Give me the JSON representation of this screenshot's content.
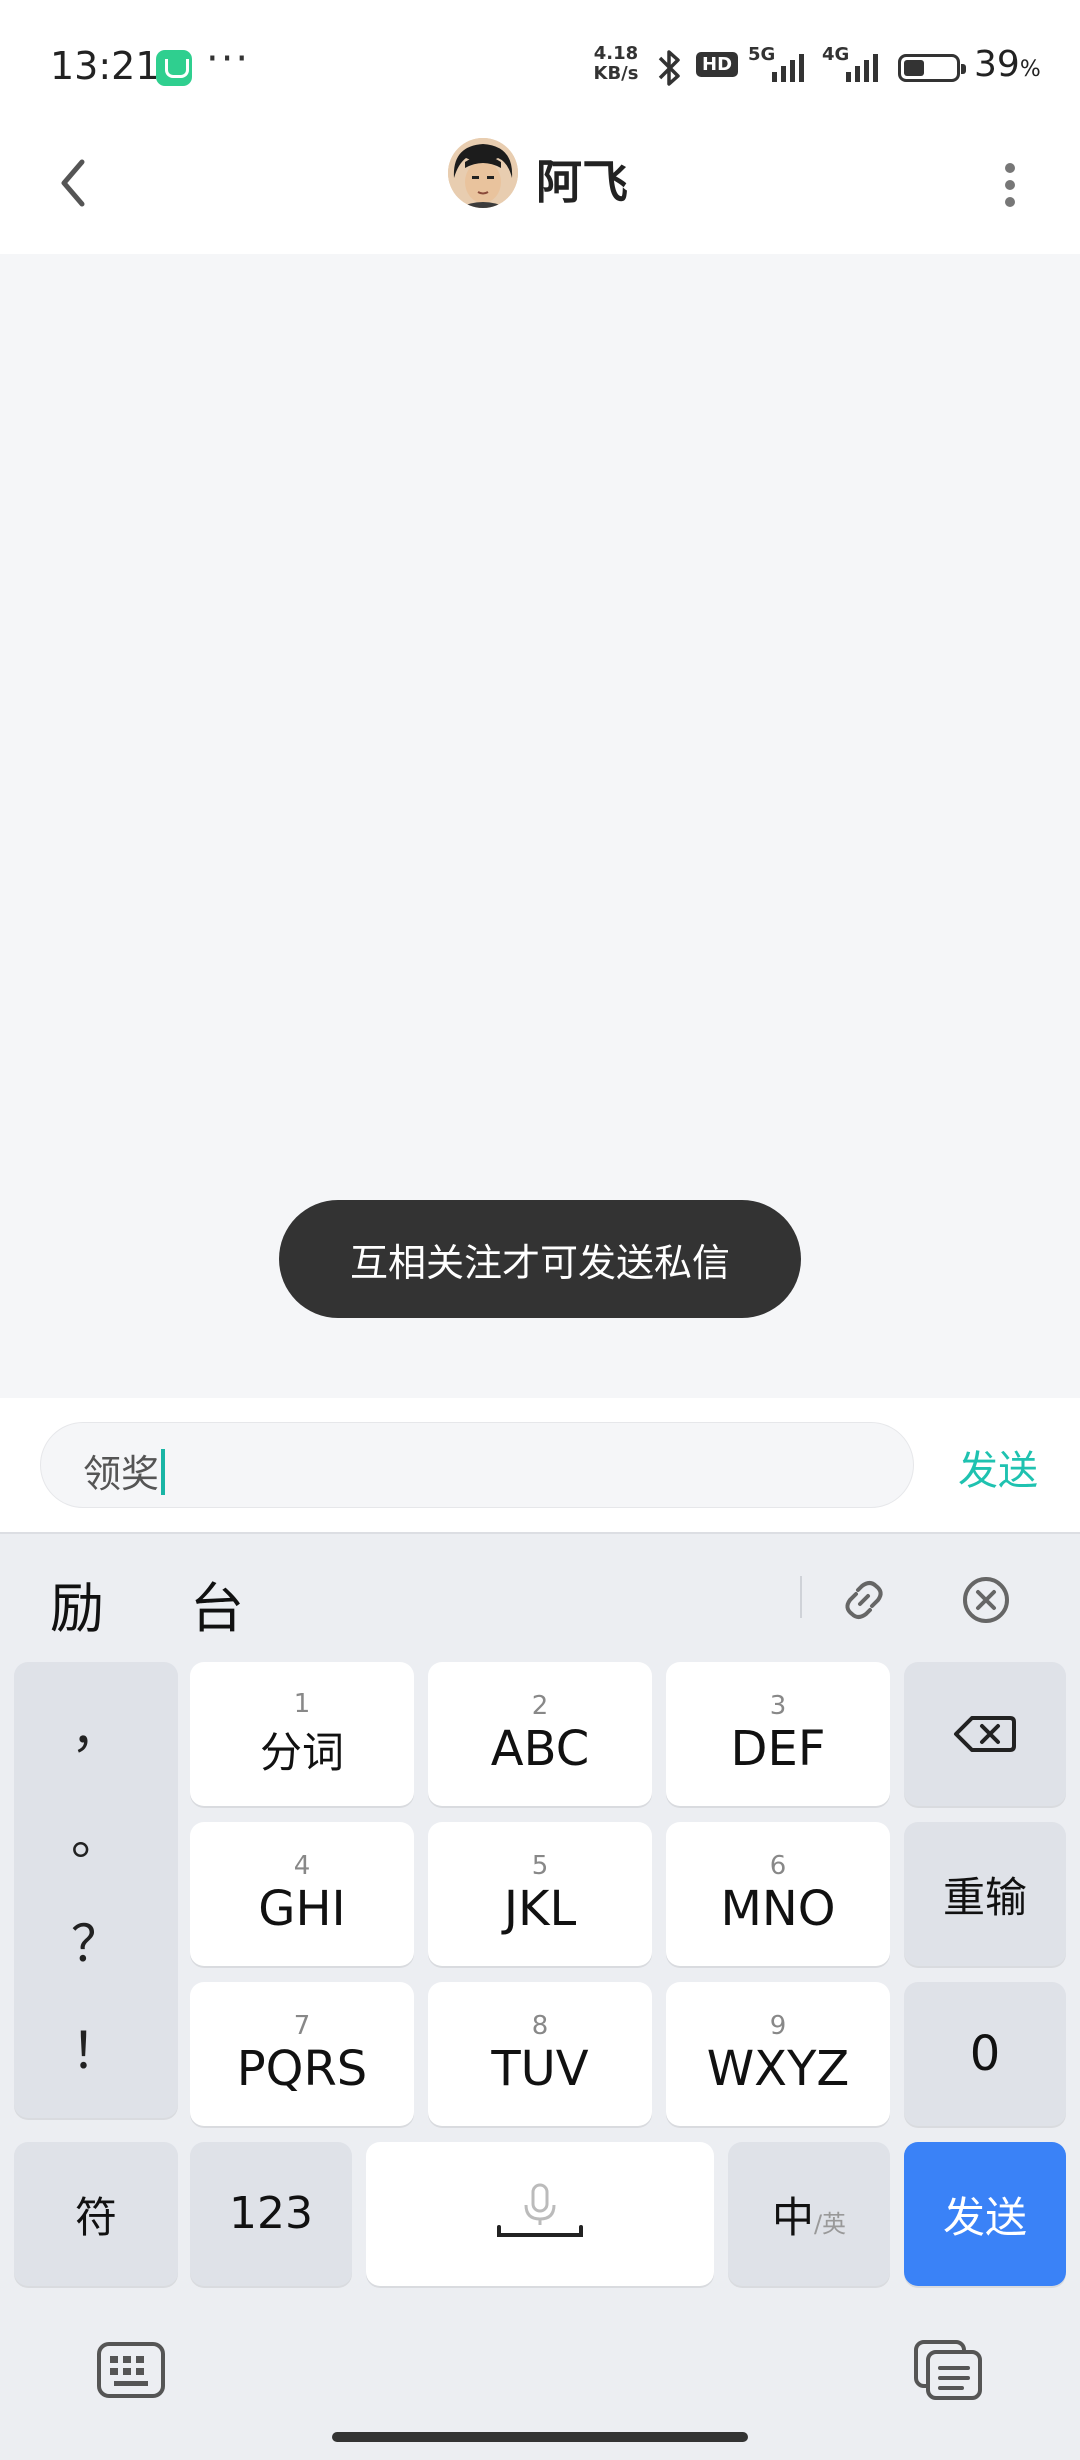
{
  "status_bar": {
    "time": "13:21",
    "more": "···",
    "speed_value": "4.18",
    "speed_unit": "KB/s",
    "hd_badge": "HD",
    "network_5g": "5G",
    "network_4g": "4G",
    "battery_percent": "39",
    "battery_percent_sign": "%",
    "battery_level": 0.39
  },
  "header": {
    "title": "阿飞",
    "back_icon": "chevron-left-icon",
    "more_icon": "vertical-dots-icon"
  },
  "chat": {
    "toast": "互相关注才可发送私信"
  },
  "input": {
    "value": "领奖",
    "send_label": "发送",
    "accent_color": "#1fc2b0"
  },
  "keyboard": {
    "candidates": [
      "励",
      "台"
    ],
    "punctuation": [
      "，",
      "。",
      "？",
      "！"
    ],
    "keys": [
      {
        "num": "1",
        "label": "分词"
      },
      {
        "num": "2",
        "label": "ABC"
      },
      {
        "num": "3",
        "label": "DEF"
      },
      {
        "num": "4",
        "label": "GHI"
      },
      {
        "num": "5",
        "label": "JKL"
      },
      {
        "num": "6",
        "label": "MNO"
      },
      {
        "num": "7",
        "label": "PQRS"
      },
      {
        "num": "8",
        "label": "TUV"
      },
      {
        "num": "9",
        "label": "WXYZ"
      }
    ],
    "reenter_label": "重输",
    "zero_label": "0",
    "symbols_label": "符",
    "numeric_label": "123",
    "lang_main": "中",
    "lang_alt": "/英",
    "send_label": "发送",
    "send_color": "#3a82f7"
  }
}
